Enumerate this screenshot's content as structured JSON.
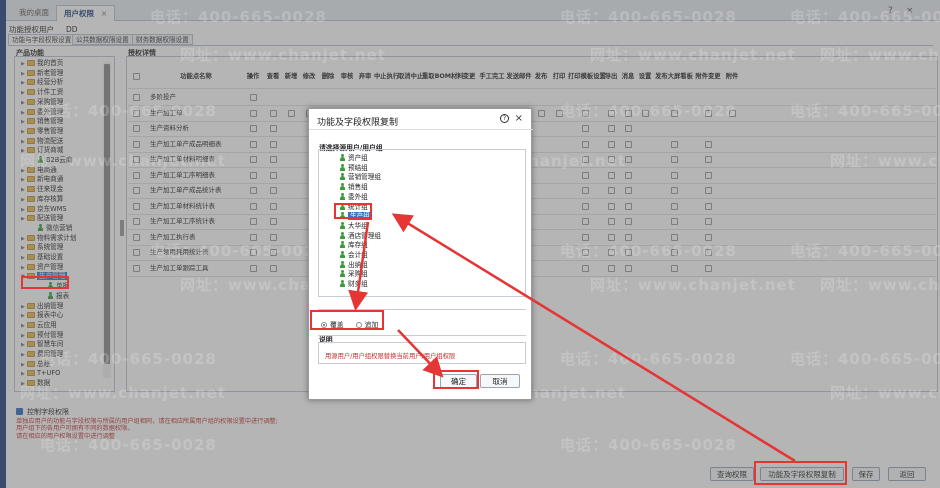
{
  "tabs": [
    {
      "label": "我的桌面"
    },
    {
      "label": "用户权限",
      "close": "×"
    }
  ],
  "window_controls": {
    "help": "?",
    "close": "×"
  },
  "user_line": {
    "label": "功能授权用户",
    "value": "DD"
  },
  "subtabs": [
    "功能与字段权限设置",
    "公共数据权限设置",
    "财务数据权限设置"
  ],
  "product_panel": {
    "title": "产品功能"
  },
  "tree": [
    {
      "label": "我的首页",
      "type": "folder",
      "indent": 1
    },
    {
      "label": "新老管理",
      "type": "folder",
      "indent": 1
    },
    {
      "label": "经营分析",
      "type": "folder",
      "indent": 1
    },
    {
      "label": "计件工资",
      "type": "folder",
      "indent": 1
    },
    {
      "label": "采购管理",
      "type": "folder",
      "indent": 1
    },
    {
      "label": "委外管理",
      "type": "folder",
      "indent": 1
    },
    {
      "label": "销售管理",
      "type": "folder",
      "indent": 1
    },
    {
      "label": "零售管理",
      "type": "folder",
      "indent": 1
    },
    {
      "label": "物流配送",
      "type": "folder",
      "indent": 1
    },
    {
      "label": "订货商城",
      "type": "folder",
      "indent": 1
    },
    {
      "label": "B2B云商",
      "type": "person",
      "indent": 2
    },
    {
      "label": "电商通",
      "type": "folder",
      "indent": 1
    },
    {
      "label": "新电商通",
      "type": "folder",
      "indent": 1
    },
    {
      "label": "往来现金",
      "type": "folder",
      "indent": 1
    },
    {
      "label": "库存核算",
      "type": "folder",
      "indent": 1
    },
    {
      "label": "京东WMS",
      "type": "folder",
      "indent": 1
    },
    {
      "label": "配送管理",
      "type": "folder",
      "indent": 1
    },
    {
      "label": "微信营销",
      "type": "person",
      "indent": 2
    },
    {
      "label": "物料需求计划",
      "type": "folder",
      "indent": 1
    },
    {
      "label": "系统管理",
      "type": "folder",
      "indent": 1
    },
    {
      "label": "基础设置",
      "type": "folder",
      "indent": 1
    },
    {
      "label": "资产管理",
      "type": "folder",
      "indent": 1
    },
    {
      "label": "生产管理",
      "type": "folder",
      "indent": 1,
      "selected": true
    },
    {
      "label": "单据",
      "type": "person",
      "indent": 3
    },
    {
      "label": "报表",
      "type": "person",
      "indent": 3
    },
    {
      "label": "出纳管理",
      "type": "folder",
      "indent": 1
    },
    {
      "label": "报表中心",
      "type": "folder",
      "indent": 1
    },
    {
      "label": "云应用",
      "type": "folder",
      "indent": 1
    },
    {
      "label": "预付管理",
      "type": "folder",
      "indent": 1
    },
    {
      "label": "智慧车间",
      "type": "folder",
      "indent": 1
    },
    {
      "label": "费用管理",
      "type": "folder",
      "indent": 1
    },
    {
      "label": "总账",
      "type": "folder",
      "indent": 1
    },
    {
      "label": "T+UFO",
      "type": "folder",
      "indent": 1
    },
    {
      "label": "数据",
      "type": "folder",
      "indent": 1
    }
  ],
  "grid": {
    "title": "授权详情",
    "columns": [
      "功能点名称",
      "操作",
      "查看",
      "新增",
      "修改",
      "删除",
      "审核",
      "弃审",
      "中止执行",
      "取消中止",
      "重取BOM材料",
      "变更",
      "手工完工",
      "发送邮件",
      "发布",
      "打印",
      "打印模板设置",
      "导出",
      "消息",
      "设置",
      "发布大屏看板",
      "附件变更",
      "附件"
    ],
    "rows": [
      {
        "name": "多阶投产",
        "checks": [
          1,
          0,
          0,
          0,
          0,
          0,
          0,
          0,
          0,
          0,
          0,
          0,
          0,
          0,
          0,
          0,
          0,
          0,
          0,
          0,
          0,
          0
        ]
      },
      {
        "name": "生产加工单",
        "checks": [
          1,
          1,
          1,
          1,
          1,
          1,
          1,
          1,
          1,
          1,
          1,
          1,
          1,
          1,
          1,
          1,
          1,
          1,
          1,
          1,
          1,
          1
        ]
      },
      {
        "name": "生产资料分析",
        "checks": [
          1,
          1,
          0,
          0,
          0,
          0,
          0,
          0,
          0,
          0,
          0,
          0,
          0,
          0,
          0,
          1,
          1,
          1,
          0,
          0,
          0,
          0
        ]
      },
      {
        "name": "生产加工单产成品明细表",
        "checks": [
          1,
          1,
          0,
          0,
          0,
          0,
          0,
          0,
          0,
          0,
          0,
          0,
          0,
          0,
          0,
          1,
          1,
          1,
          0,
          1,
          1,
          0
        ]
      },
      {
        "name": "生产加工单材料明细表",
        "checks": [
          1,
          1,
          0,
          0,
          0,
          0,
          0,
          0,
          0,
          0,
          0,
          0,
          0,
          0,
          0,
          1,
          1,
          1,
          0,
          1,
          1,
          0
        ]
      },
      {
        "name": "生产加工单工序明细表",
        "checks": [
          1,
          1,
          0,
          0,
          0,
          0,
          0,
          0,
          0,
          0,
          0,
          0,
          0,
          0,
          0,
          1,
          1,
          1,
          0,
          1,
          1,
          0
        ]
      },
      {
        "name": "生产加工单产成品统计表",
        "checks": [
          1,
          1,
          0,
          0,
          0,
          0,
          0,
          0,
          0,
          0,
          0,
          0,
          0,
          0,
          0,
          1,
          1,
          1,
          0,
          1,
          1,
          0
        ]
      },
      {
        "name": "生产加工单材料统计表",
        "checks": [
          1,
          1,
          0,
          0,
          0,
          0,
          0,
          0,
          0,
          0,
          0,
          0,
          0,
          0,
          0,
          1,
          1,
          1,
          0,
          1,
          1,
          0
        ]
      },
      {
        "name": "生产加工单工序统计表",
        "checks": [
          1,
          1,
          0,
          0,
          0,
          0,
          0,
          0,
          0,
          0,
          0,
          0,
          0,
          0,
          0,
          1,
          1,
          1,
          0,
          1,
          1,
          0
        ]
      },
      {
        "name": "生产加工执行表",
        "checks": [
          1,
          1,
          0,
          0,
          0,
          0,
          0,
          0,
          0,
          0,
          0,
          0,
          0,
          0,
          0,
          1,
          1,
          1,
          0,
          1,
          1,
          0
        ]
      },
      {
        "name": "生产领用耗用统计表",
        "checks": [
          1,
          1,
          0,
          0,
          0,
          0,
          0,
          0,
          0,
          0,
          0,
          0,
          0,
          0,
          0,
          1,
          1,
          1,
          0,
          1,
          1,
          0
        ]
      },
      {
        "name": "生产加工单跟踪工具",
        "checks": [
          1,
          1,
          0,
          0,
          0,
          0,
          0,
          0,
          0,
          0,
          0,
          0,
          0,
          0,
          0,
          1,
          1,
          1,
          0,
          1,
          1,
          0
        ]
      }
    ]
  },
  "field_control": {
    "label": "控制字段权限",
    "checked": true
  },
  "notes": [
    "单独应用户的功能与字段权限与所属的用户组相同，请在相应所属用户组的权限设置中进行调整;",
    "用户组下的各用户可拥有不同的数据权限。",
    "请在相应的用户权限设置中进行调整"
  ],
  "buttons": {
    "query": "查询权限",
    "copy": "功能及字段权限复制",
    "save": "保存",
    "back": "返回"
  },
  "dialog": {
    "title": "功能及字段权限复制",
    "help": "?",
    "close": "×",
    "select_label": "请选择源用户/用户组",
    "items": [
      "资产组",
      "预结组",
      "营销管理组",
      "销售组",
      "委外组",
      "统计组",
      "生产组",
      "大华组",
      "酒店管理组",
      "库存组",
      "会计组",
      "出纳组",
      "采购组",
      "财务组"
    ],
    "selected_item": "生产组",
    "mode": {
      "overwrite": "覆盖",
      "append": "追加",
      "selected": "覆盖"
    },
    "desc_title": "说明",
    "desc_text": "用源用户/用户组权限替换当前用户/用户组权限",
    "ok": "确定",
    "cancel": "取消"
  },
  "watermark": {
    "phone": "电话：400-665-0028",
    "site": "网址：www.chanjet.net"
  },
  "colors": {
    "highlight": "#e53535",
    "selection": "#3b73c4",
    "folder": "#e9b94a",
    "person": "#3d9a3d"
  }
}
